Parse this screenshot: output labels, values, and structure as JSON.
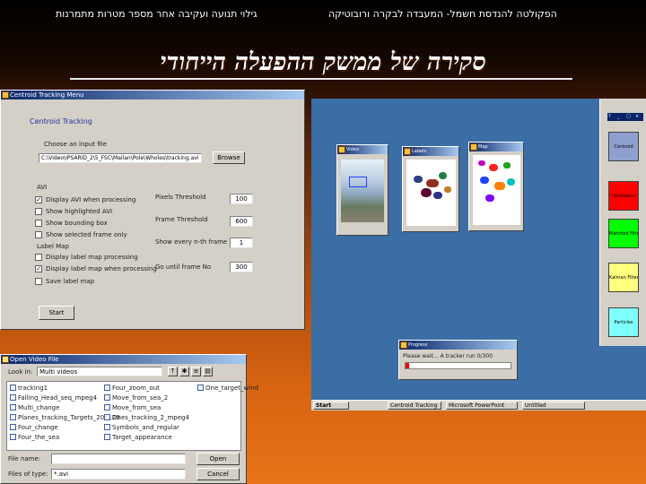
{
  "slide": {
    "header_left": "גילוי תנועה ועקיבה אחר מספר מטרות מתמרנות",
    "header_right": "הפקולטה להנדסת חשמל- המעבדה לבקרה ורובוטיקה",
    "title": "סקירה של ממשק ההפעלה הייחודי"
  },
  "tracking_menu": {
    "window_title": "Centroid Tracking Menu",
    "heading": "Centroid Tracking",
    "input_label": "Choose an input file",
    "input_value": "C:\\Video\\IPSARID_2\\5_FSC\\Mailan\\Pole\\Wholes\\tracking.avi",
    "browse": "Browse",
    "avi_group": "AVI",
    "options": [
      {
        "label": "Display AVI when processing",
        "checked": true
      },
      {
        "label": "Show highlighted AVI",
        "checked": false
      },
      {
        "label": "Show bounding box",
        "checked": false
      },
      {
        "label": "Show selected frame only",
        "checked": false
      }
    ],
    "label_map_group": "Label Map",
    "label_options": [
      {
        "label": "Display label map processing",
        "checked": false
      },
      {
        "label": "Display label map when processing",
        "checked": true
      },
      {
        "label": "Save label map",
        "checked": false
      }
    ],
    "params": [
      {
        "label": "Pixels Threshold",
        "value": "100"
      },
      {
        "label": "Frame Threshold",
        "value": "600"
      },
      {
        "label": "Show every n-th frame",
        "value": "1"
      },
      {
        "label": "Go until frame No",
        "value": "300"
      }
    ],
    "start": "Start"
  },
  "open_dialog": {
    "window_title": "Open Video File",
    "look_in_label": "Look in:",
    "look_in_value": "Multi videos",
    "files_col1": [
      "tracking1",
      "Falling_Head_seq_mpeg4",
      "Multi_change",
      "Planes_tracking_Targets_20x120",
      "Four_change",
      "Four_the_sea"
    ],
    "files_col2": [
      "Four_zoom_out",
      "Move_from_sea_2",
      "Move_from_sea",
      "Ones_tracking_2_mpeg4",
      "Symbols_and_regular",
      "Target_appearance"
    ],
    "files_col3": [
      "One_target_wind"
    ],
    "file_name_label": "File name:",
    "file_name_value": "",
    "files_type_label": "Files of type:",
    "files_type_value": "*.avi",
    "open": "Open",
    "cancel": "Cancel"
  },
  "small_windows": {
    "video_title": "Video",
    "labels_title": "Labels",
    "map_title": "Map"
  },
  "progress": {
    "title": "Progress",
    "text": "Please wait... A tracker run 0/300",
    "fraction": 0.03
  },
  "palette": {
    "title_buttons": [
      "?",
      "_",
      "□",
      "×"
    ],
    "buttons": [
      {
        "label": "Centroid",
        "color": "#8fa0d0"
      },
      {
        "label": "Correlation",
        "color": "#ff0000"
      },
      {
        "label": "Matched Filter",
        "color": "#00ff00"
      },
      {
        "label": "Kalman Filter",
        "color": "#ffff80"
      },
      {
        "label": "Particles",
        "color": "#80ffff"
      }
    ]
  },
  "taskbar": {
    "start": "Start",
    "items": [
      "Centroid Tracking",
      "Microsoft PowerPoint",
      "Untitled"
    ]
  },
  "colors": {
    "accent_titlebar": "#0a246a",
    "desktop": "#3a6ea5",
    "window_face": "#d4d0c8"
  }
}
